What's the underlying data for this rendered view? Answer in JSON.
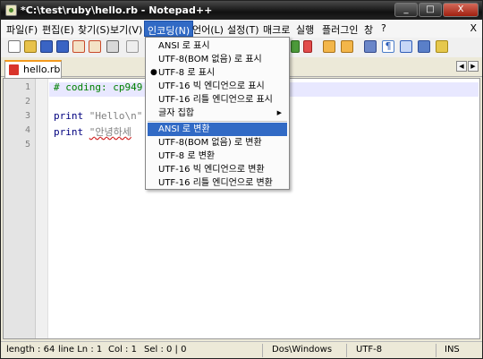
{
  "window": {
    "title": "*C:\\test\\ruby\\hello.rb - Notepad++",
    "minimize_glyph": "_",
    "maximize_glyph": "□",
    "close_glyph": "X"
  },
  "menubar": {
    "items": [
      "파일(F)",
      "편집(E)",
      "찾기(S)",
      "보기(V)",
      "인코딩(N)",
      "언어(L)",
      "설정(T)",
      "매크로",
      "실행",
      "플러그인",
      "창",
      "?"
    ],
    "open_item": "인코딩(N)",
    "close_glyph": "X"
  },
  "toolbar": {
    "icons": [
      "new-file-icon",
      "open-file-icon",
      "save-icon",
      "save-all-icon",
      "close-icon",
      "close-all-icon",
      "print-icon",
      "cut-icon",
      "copy-icon",
      "paste-icon",
      "undo-icon",
      "redo-icon",
      "find-icon",
      "replace-icon",
      "zoom-in-icon",
      "zoom-out-icon",
      "sync-icon",
      "wrap-icon",
      "show-all-chars-icon",
      "indent-guide-icon",
      "user-lang-icon"
    ]
  },
  "tabs": [
    {
      "label": "hello.rb",
      "active": true
    }
  ],
  "tab_arrows": {
    "left": "◀",
    "right": "▶"
  },
  "editor": {
    "lines": [
      {
        "num": "1",
        "text": "# coding: cp949",
        "kind": "comment"
      },
      {
        "num": "2",
        "text": "",
        "kind": "blank"
      },
      {
        "num": "3",
        "keyword": "print",
        "string": "\"Hello\\n\"",
        "kind": "print"
      },
      {
        "num": "4",
        "keyword": "print",
        "string": "\"안녕하세",
        "kind": "print"
      },
      {
        "num": "5",
        "text": "",
        "kind": "blank"
      }
    ]
  },
  "encoding_menu": {
    "items": [
      {
        "label": "ANSI 로 표시",
        "checked": false,
        "highlighted": false
      },
      {
        "label": "UTF-8(BOM 없음) 로 표시",
        "checked": false,
        "highlighted": false
      },
      {
        "label": "UTF-8 로 표시",
        "checked": true,
        "highlighted": false
      },
      {
        "label": "UTF-16 빅 엔디언으로 표시",
        "checked": false,
        "highlighted": false
      },
      {
        "label": "UTF-16 리틀 엔디언으로 표시",
        "checked": false,
        "highlighted": false
      },
      {
        "label": "글자 집합",
        "checked": false,
        "highlighted": false,
        "submenu": true
      },
      {
        "label": "ANSI 로 변환",
        "checked": false,
        "highlighted": true
      },
      {
        "label": "UTF-8(BOM 없음) 로 변환",
        "checked": false,
        "highlighted": false
      },
      {
        "label": "UTF-8 로 변환",
        "checked": false,
        "highlighted": false
      },
      {
        "label": "UTF-16 빅 엔디언으로 변환",
        "checked": false,
        "highlighted": false
      },
      {
        "label": "UTF-16 리틀 엔디언으로 변환",
        "checked": false,
        "highlighted": false
      }
    ],
    "check_glyph": "●",
    "submenu_glyph": "▶"
  },
  "statusbar": {
    "length": "length : 64",
    "line": "line Ln : 1",
    "col": "Col : 1",
    "sel": "Sel : 0 | 0",
    "eol": "Dos\\Windows",
    "encoding": "UTF-8",
    "mode": "INS"
  }
}
